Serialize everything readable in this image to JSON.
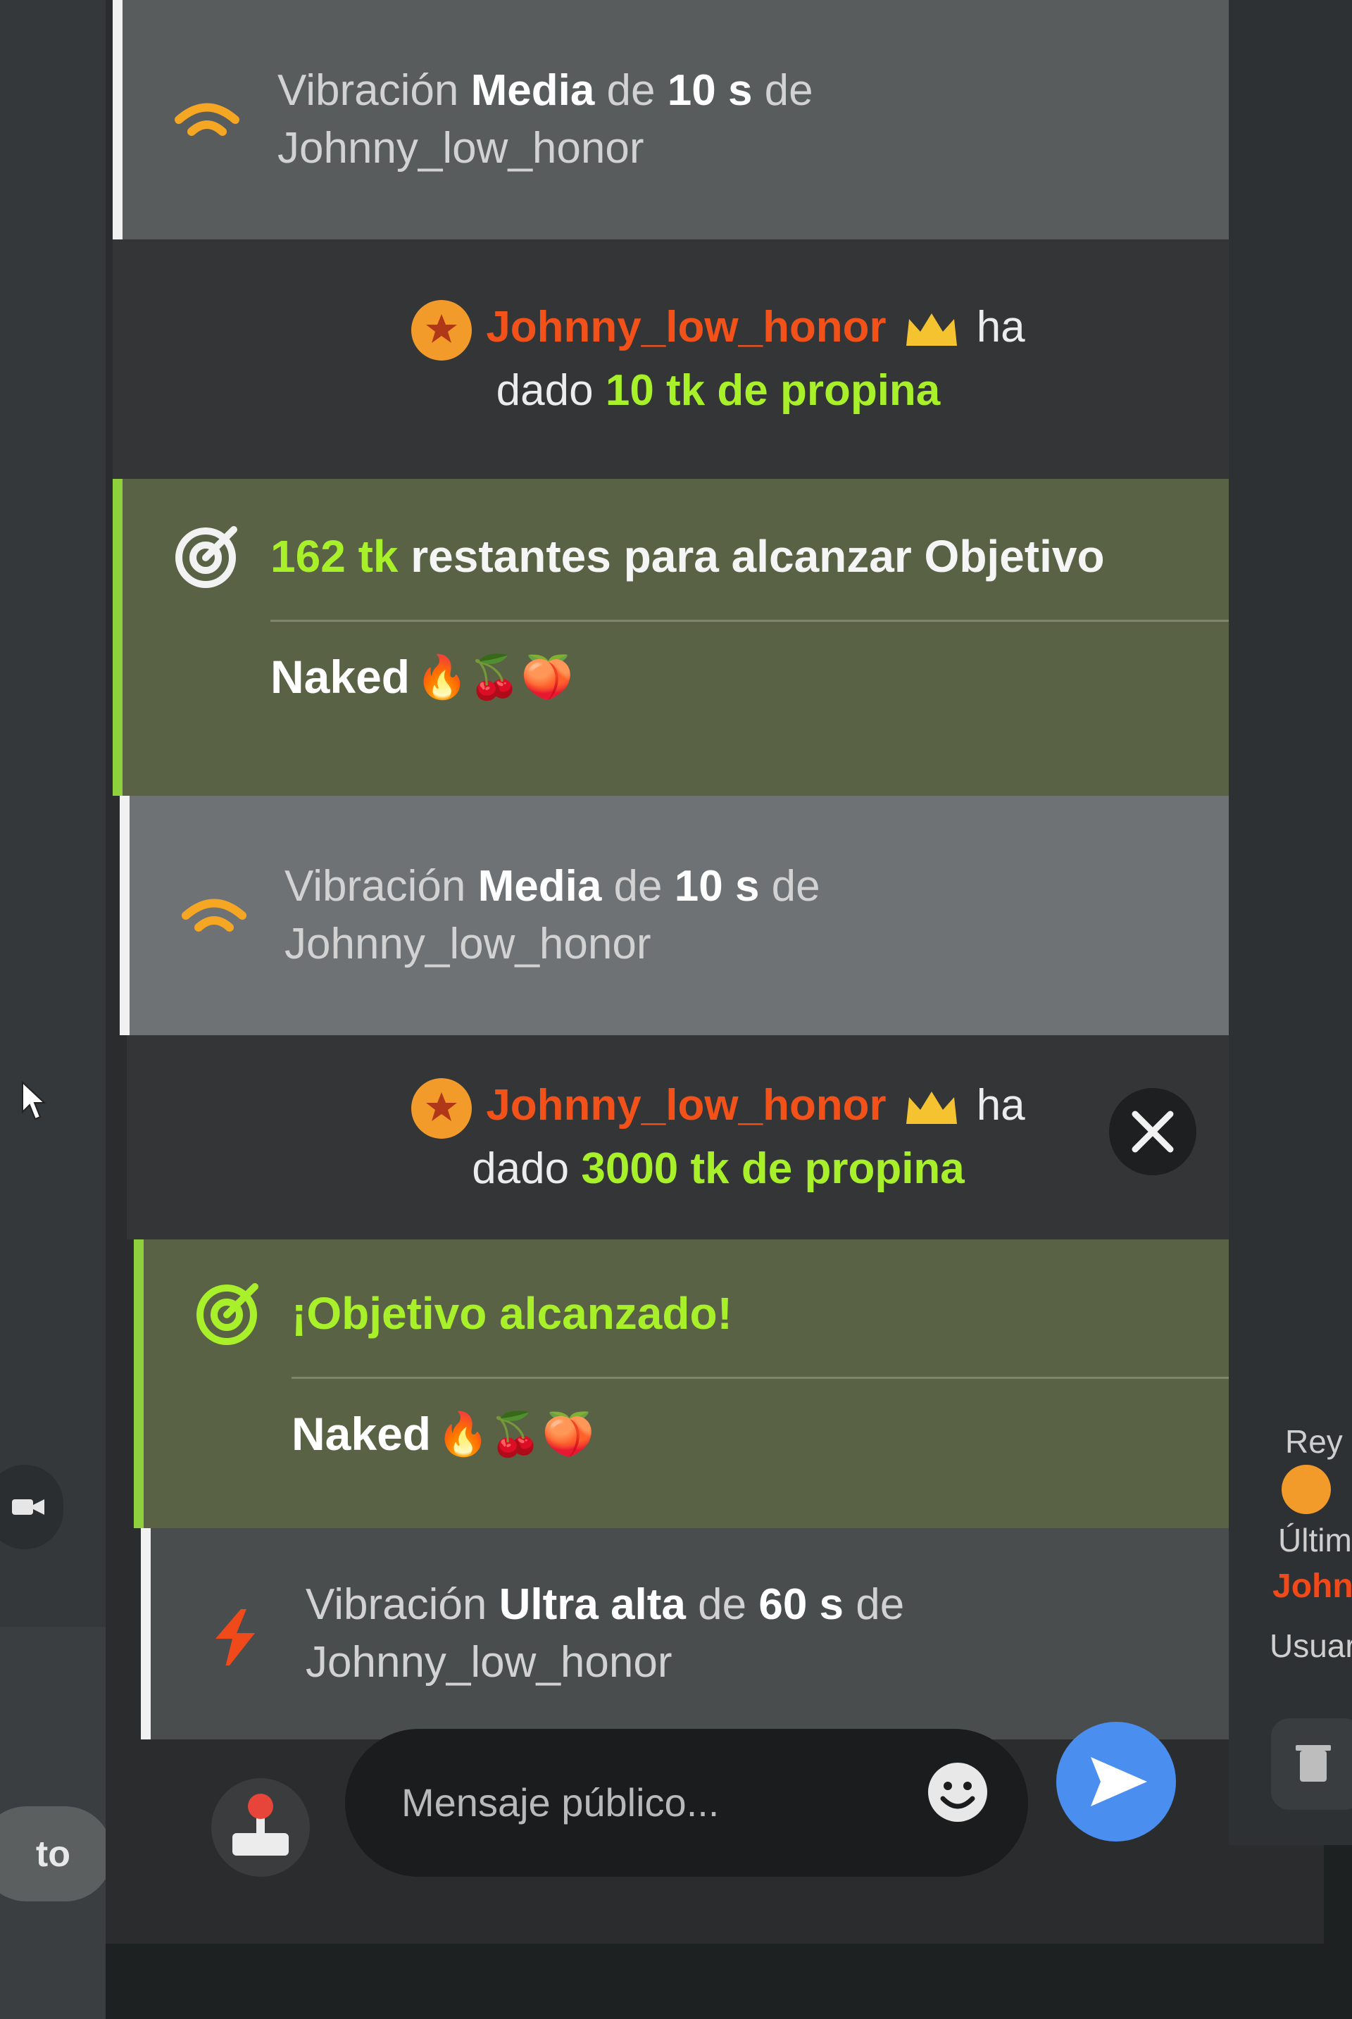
{
  "chat": {
    "messages": [
      {
        "type": "vibration",
        "prefix": "Vibración",
        "level": "Media",
        "mid": "de",
        "duration": "10 s",
        "suffix": "de",
        "user": "Johnny_low_honor",
        "icon": "vibration-medium-icon",
        "color": "#f5a623"
      },
      {
        "type": "tip",
        "user": "Johnny_low_honor",
        "verb": "ha",
        "dado": "dado",
        "amount": "10 tk de propina"
      },
      {
        "type": "goal",
        "remaining_amount": "162 tk",
        "remaining_text": "restantes para alcanzar Objetivo",
        "goal_name": "Naked",
        "goal_emojis": "🔥🍒🍑"
      },
      {
        "type": "vibration",
        "prefix": "Vibración",
        "level": "Media",
        "mid": "de",
        "duration": "10 s",
        "suffix": "de",
        "user": "Johnny_low_honor",
        "icon": "vibration-medium-icon",
        "color": "#f5a623"
      },
      {
        "type": "tip",
        "user": "Johnny_low_honor",
        "verb": "ha",
        "dado": "dado",
        "amount": "3000 tk de propina"
      },
      {
        "type": "goal",
        "reached_text": "¡Objetivo alcanzado!",
        "goal_name": "Naked",
        "goal_emojis": "🔥🍒🍑"
      },
      {
        "type": "vibration",
        "prefix": "Vibración",
        "level": "Ultra alta",
        "mid": "de",
        "duration": "60 s",
        "suffix": "de",
        "user": "Johnny_low_honor",
        "icon": "lightning-icon",
        "color": "#f0491a"
      }
    ]
  },
  "composer": {
    "placeholder": "Mensaje público..."
  },
  "left": {
    "pill_text": "to"
  },
  "right_panel": {
    "rey_label": "Rey",
    "ultimo_label": "Últim",
    "last_user": "John",
    "usuarios_label": "Usuar"
  },
  "colors": {
    "accent_green": "#a8f02a",
    "username_orange": "#f2511a",
    "send_blue": "#4a8ef0"
  }
}
